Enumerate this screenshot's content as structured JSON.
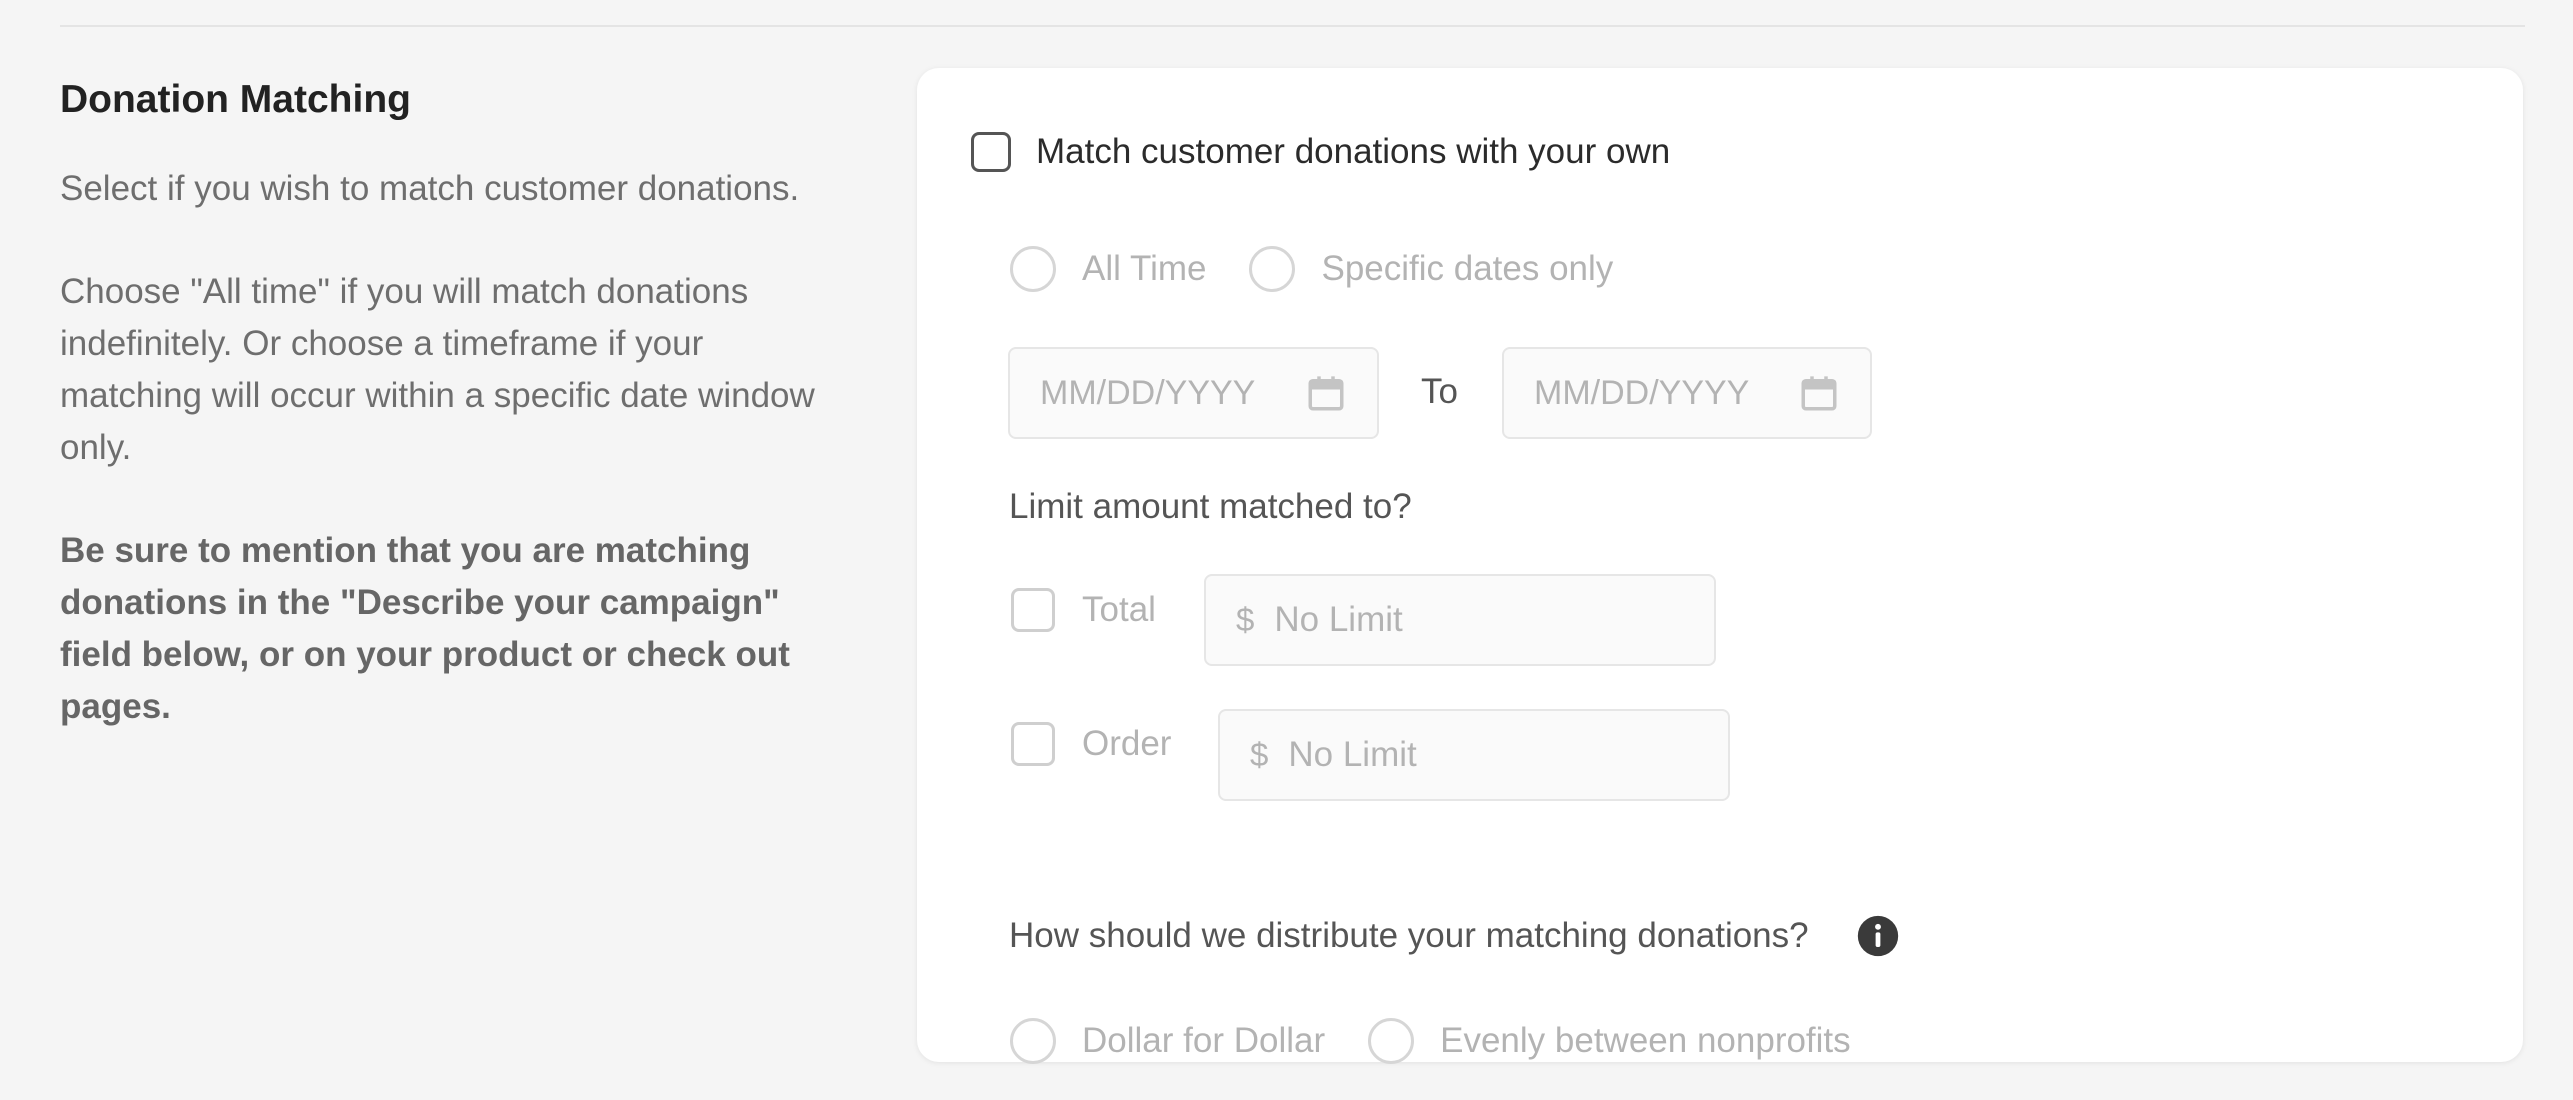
{
  "section": {
    "title": "Donation Matching",
    "desc1": "Select if you wish to match customer donations.",
    "desc2": "Choose \"All time\" if you will match donations indefinitely. Or choose a timeframe if your matching will occur within a specific date window only.",
    "desc3": "Be sure to mention that you are matching donations in the \"Describe your campaign\" field below, or on your product or check out pages."
  },
  "form": {
    "match_checkbox_label": "Match customer donations with your own",
    "match_checked": false,
    "timeframe_options": [
      "All Time",
      "Specific dates only"
    ],
    "start_date_placeholder": "MM/DD/YYYY",
    "to_label": "To",
    "end_date_placeholder": "MM/DD/YYYY",
    "limit_question": "Limit amount matched to?",
    "limit_total_label": "Total",
    "limit_order_label": "Order",
    "currency_symbol": "$",
    "no_limit_placeholder": "No Limit",
    "distribute_question": "How should we distribute your matching donations?",
    "distribute_options": [
      "Dollar for Dollar",
      "Evenly between nonprofits"
    ]
  },
  "icons": {
    "calendar": "calendar-icon",
    "info": "info-icon"
  },
  "colors": {
    "background": "#f5f5f5",
    "card": "#ffffff",
    "disabled_text": "#b3b3b3",
    "info_icon": "#3a3a3a"
  }
}
